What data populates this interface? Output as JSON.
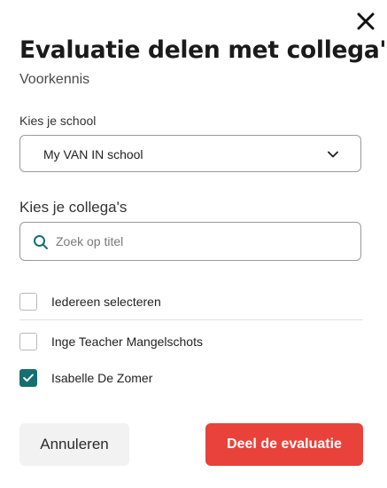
{
  "dialog": {
    "title": "Evaluatie delen met collega's",
    "subtitle": "Voorkennis"
  },
  "school": {
    "label": "Kies je school",
    "selected": "My VAN IN school"
  },
  "colleagues": {
    "label": "Kies je collega's",
    "search_placeholder": "Zoek op titel",
    "select_all": {
      "label": "Iedereen selecteren",
      "checked": false
    },
    "items": [
      {
        "label": "Inge Teacher Mangelschots",
        "checked": false
      },
      {
        "label": "Isabelle De Zomer",
        "checked": true
      }
    ]
  },
  "actions": {
    "cancel_label": "Annuleren",
    "share_label": "Deel de evaluatie"
  },
  "colors": {
    "accent": "#e8423a",
    "checkbox_checked": "#156e70",
    "search_icon": "#156e70"
  },
  "icons": {
    "close": "close-icon",
    "chevron": "chevron-down-icon",
    "search": "search-icon",
    "check": "checkmark-icon"
  }
}
